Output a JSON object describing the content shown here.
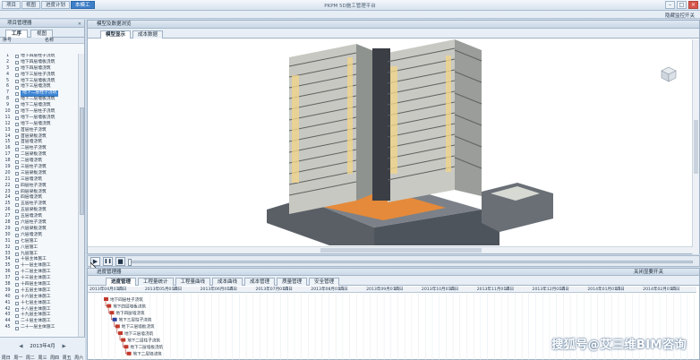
{
  "app": {
    "title": "PKPM 5D施工管理平台",
    "menu": [
      "项目",
      "视图",
      "进度计划",
      "本模工"
    ],
    "active_menu_index": 3,
    "toolbar_right": "隐藏监控开关"
  },
  "left_panel": {
    "title": "项目管理器",
    "tabs": [
      "工序",
      "视图"
    ],
    "active_tab": 0,
    "col_num": "序号",
    "col_name": "名称",
    "rows": [
      {
        "n": "1",
        "name": "地下四层柱子浇筑"
      },
      {
        "n": "2",
        "name": "地下四层墙板浇筑"
      },
      {
        "n": "3",
        "name": "地下四层墙浇筑"
      },
      {
        "n": "4",
        "name": "地下三层柱子浇筑"
      },
      {
        "n": "5",
        "name": "地下三层墙板浇筑"
      },
      {
        "n": "6",
        "name": "地下三层墙浇筑"
      },
      {
        "n": "7",
        "name": "地下二层柱子浇筑",
        "selected": true
      },
      {
        "n": "8",
        "name": "地下二层墙板浇筑"
      },
      {
        "n": "9",
        "name": "地下二层墙浇筑"
      },
      {
        "n": "10",
        "name": "地下一层柱子浇筑"
      },
      {
        "n": "11",
        "name": "地下一层墙板浇筑"
      },
      {
        "n": "12",
        "name": "地下一层墙浇筑"
      },
      {
        "n": "13",
        "name": "首层柱子浇筑"
      },
      {
        "n": "14",
        "name": "首层梁板浇筑"
      },
      {
        "n": "15",
        "name": "首层墙浇筑"
      },
      {
        "n": "16",
        "name": "二层柱子浇筑"
      },
      {
        "n": "17",
        "name": "二层梁板浇筑"
      },
      {
        "n": "18",
        "name": "二层墙浇筑"
      },
      {
        "n": "19",
        "name": "三层柱子浇筑"
      },
      {
        "n": "20",
        "name": "三层梁板浇筑"
      },
      {
        "n": "21",
        "name": "三层墙浇筑"
      },
      {
        "n": "22",
        "name": "四层柱子浇筑"
      },
      {
        "n": "23",
        "name": "四层梁板浇筑"
      },
      {
        "n": "24",
        "name": "四层墙浇筑"
      },
      {
        "n": "25",
        "name": "五层柱子浇筑"
      },
      {
        "n": "26",
        "name": "五层梁板浇筑"
      },
      {
        "n": "27",
        "name": "五层墙浇筑"
      },
      {
        "n": "28",
        "name": "六层柱子浇筑"
      },
      {
        "n": "29",
        "name": "六层梁板浇筑"
      },
      {
        "n": "30",
        "name": "六层墙浇筑"
      },
      {
        "n": "31",
        "name": "七层施工"
      },
      {
        "n": "32",
        "name": "八层施工"
      },
      {
        "n": "33",
        "name": "九层施工"
      },
      {
        "n": "34",
        "name": "十层主体施工"
      },
      {
        "n": "35",
        "name": "十一层主体施工"
      },
      {
        "n": "36",
        "name": "十二层主体施工"
      },
      {
        "n": "37",
        "name": "十三层主体施工"
      },
      {
        "n": "38",
        "name": "十四层主体施工"
      },
      {
        "n": "39",
        "name": "十五层主体施工"
      },
      {
        "n": "40",
        "name": "十六层主体施工"
      },
      {
        "n": "41",
        "name": "十七层主体施工"
      },
      {
        "n": "42",
        "name": "十八层主体施工"
      },
      {
        "n": "43",
        "name": "十九层主体施工"
      },
      {
        "n": "44",
        "name": "二十层主体施工"
      },
      {
        "n": "45",
        "name": "二十一层主体施工"
      }
    ],
    "calendar_month": "2013年4月",
    "calendar_days": [
      "周日",
      "周一",
      "周二",
      "周三",
      "周四",
      "周五",
      "周六"
    ]
  },
  "viewer": {
    "title": "模型及数据浏览",
    "tabs": [
      "模型显示",
      "成本数据"
    ],
    "active_tab": 0
  },
  "player": {
    "play": "▶",
    "pause": "❚❚",
    "stop": "■",
    "progress": 0
  },
  "gantt": {
    "title": "进度管理器",
    "right_label": "关闭显要开关",
    "tabs": [
      "进度管理",
      "工程量统计",
      "工程量曲线",
      "成本曲线",
      "成本管理",
      "质量管理",
      "安全管理"
    ],
    "active_tab": 0,
    "timescale": [
      "2013年04月01日",
      "15日",
      "2013年05月01日",
      "15日",
      "2013年06月01日",
      "15日",
      "2013年07月01日",
      "15日",
      "2013年08月01日",
      "15日",
      "2013年09月01日",
      "15日",
      "2013年10月01日",
      "15日",
      "2013年11月01日",
      "15日",
      "2013年12月01日",
      "15日",
      "2014年01月01日",
      "15日",
      "2014年02月01日",
      "15日"
    ],
    "bars": [
      {
        "label": "地下四层柱子浇筑",
        "color": "#c0392b"
      },
      {
        "label": "地下四层墙板浇筑",
        "color": "#c0392b"
      },
      {
        "label": "地下四层墙浇筑",
        "color": "#c0392b"
      },
      {
        "label": "地下三层柱子浇筑",
        "color": "#2c3e9e"
      },
      {
        "label": "地下三层墙板浇筑",
        "color": "#c0392b"
      },
      {
        "label": "地下三层墙浇筑",
        "color": "#c0392b"
      },
      {
        "label": "地下二层柱子浇筑",
        "color": "#c0392b"
      },
      {
        "label": "地下二层墙板浇筑",
        "color": "#c0392b"
      },
      {
        "label": "地下二层墙浇筑",
        "color": "#c0392b"
      }
    ],
    "watermark": "搜狐号@艾三维BIM咨询"
  }
}
